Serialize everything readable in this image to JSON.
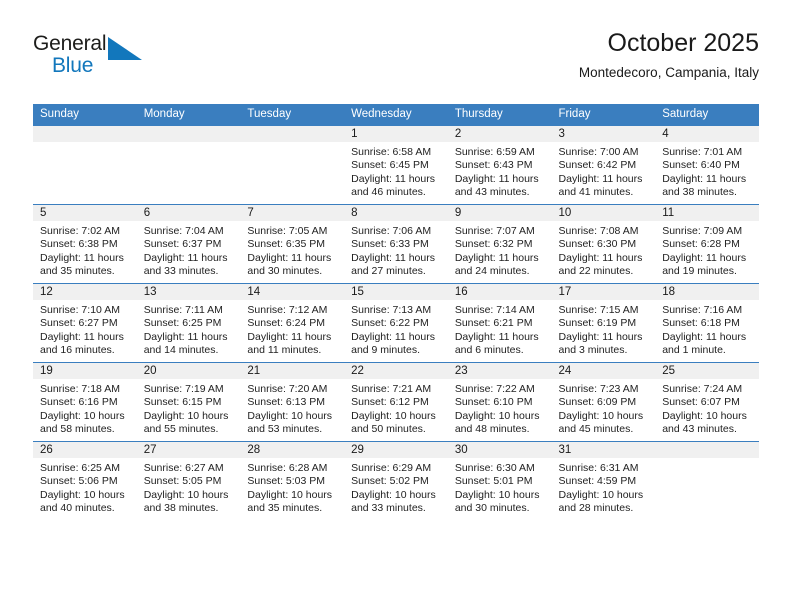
{
  "brand": {
    "name_part1": "General",
    "name_part2": "Blue",
    "triangle_color": "#1277bc"
  },
  "header": {
    "title": "October 2025",
    "subtitle": "Montedecoro, Campania, Italy",
    "accent_color": "#3a7ebf",
    "daynum_band_color": "#f0f0f0"
  },
  "weekday_headers": [
    "Sunday",
    "Monday",
    "Tuesday",
    "Wednesday",
    "Thursday",
    "Friday",
    "Saturday"
  ],
  "weeks": [
    {
      "days": [
        {
          "daynum": "",
          "sunrise": "",
          "sunset": "",
          "daylight_line1": "",
          "daylight_line2": "",
          "empty": true
        },
        {
          "daynum": "",
          "sunrise": "",
          "sunset": "",
          "daylight_line1": "",
          "daylight_line2": "",
          "empty": true
        },
        {
          "daynum": "",
          "sunrise": "",
          "sunset": "",
          "daylight_line1": "",
          "daylight_line2": "",
          "empty": true
        },
        {
          "daynum": "1",
          "sunrise": "Sunrise: 6:58 AM",
          "sunset": "Sunset: 6:45 PM",
          "daylight_line1": "Daylight: 11 hours",
          "daylight_line2": "and 46 minutes.",
          "empty": false
        },
        {
          "daynum": "2",
          "sunrise": "Sunrise: 6:59 AM",
          "sunset": "Sunset: 6:43 PM",
          "daylight_line1": "Daylight: 11 hours",
          "daylight_line2": "and 43 minutes.",
          "empty": false
        },
        {
          "daynum": "3",
          "sunrise": "Sunrise: 7:00 AM",
          "sunset": "Sunset: 6:42 PM",
          "daylight_line1": "Daylight: 11 hours",
          "daylight_line2": "and 41 minutes.",
          "empty": false
        },
        {
          "daynum": "4",
          "sunrise": "Sunrise: 7:01 AM",
          "sunset": "Sunset: 6:40 PM",
          "daylight_line1": "Daylight: 11 hours",
          "daylight_line2": "and 38 minutes.",
          "empty": false
        }
      ]
    },
    {
      "days": [
        {
          "daynum": "5",
          "sunrise": "Sunrise: 7:02 AM",
          "sunset": "Sunset: 6:38 PM",
          "daylight_line1": "Daylight: 11 hours",
          "daylight_line2": "and 35 minutes.",
          "empty": false
        },
        {
          "daynum": "6",
          "sunrise": "Sunrise: 7:04 AM",
          "sunset": "Sunset: 6:37 PM",
          "daylight_line1": "Daylight: 11 hours",
          "daylight_line2": "and 33 minutes.",
          "empty": false
        },
        {
          "daynum": "7",
          "sunrise": "Sunrise: 7:05 AM",
          "sunset": "Sunset: 6:35 PM",
          "daylight_line1": "Daylight: 11 hours",
          "daylight_line2": "and 30 minutes.",
          "empty": false
        },
        {
          "daynum": "8",
          "sunrise": "Sunrise: 7:06 AM",
          "sunset": "Sunset: 6:33 PM",
          "daylight_line1": "Daylight: 11 hours",
          "daylight_line2": "and 27 minutes.",
          "empty": false
        },
        {
          "daynum": "9",
          "sunrise": "Sunrise: 7:07 AM",
          "sunset": "Sunset: 6:32 PM",
          "daylight_line1": "Daylight: 11 hours",
          "daylight_line2": "and 24 minutes.",
          "empty": false
        },
        {
          "daynum": "10",
          "sunrise": "Sunrise: 7:08 AM",
          "sunset": "Sunset: 6:30 PM",
          "daylight_line1": "Daylight: 11 hours",
          "daylight_line2": "and 22 minutes.",
          "empty": false
        },
        {
          "daynum": "11",
          "sunrise": "Sunrise: 7:09 AM",
          "sunset": "Sunset: 6:28 PM",
          "daylight_line1": "Daylight: 11 hours",
          "daylight_line2": "and 19 minutes.",
          "empty": false
        }
      ]
    },
    {
      "days": [
        {
          "daynum": "12",
          "sunrise": "Sunrise: 7:10 AM",
          "sunset": "Sunset: 6:27 PM",
          "daylight_line1": "Daylight: 11 hours",
          "daylight_line2": "and 16 minutes.",
          "empty": false
        },
        {
          "daynum": "13",
          "sunrise": "Sunrise: 7:11 AM",
          "sunset": "Sunset: 6:25 PM",
          "daylight_line1": "Daylight: 11 hours",
          "daylight_line2": "and 14 minutes.",
          "empty": false
        },
        {
          "daynum": "14",
          "sunrise": "Sunrise: 7:12 AM",
          "sunset": "Sunset: 6:24 PM",
          "daylight_line1": "Daylight: 11 hours",
          "daylight_line2": "and 11 minutes.",
          "empty": false
        },
        {
          "daynum": "15",
          "sunrise": "Sunrise: 7:13 AM",
          "sunset": "Sunset: 6:22 PM",
          "daylight_line1": "Daylight: 11 hours",
          "daylight_line2": "and 9 minutes.",
          "empty": false
        },
        {
          "daynum": "16",
          "sunrise": "Sunrise: 7:14 AM",
          "sunset": "Sunset: 6:21 PM",
          "daylight_line1": "Daylight: 11 hours",
          "daylight_line2": "and 6 minutes.",
          "empty": false
        },
        {
          "daynum": "17",
          "sunrise": "Sunrise: 7:15 AM",
          "sunset": "Sunset: 6:19 PM",
          "daylight_line1": "Daylight: 11 hours",
          "daylight_line2": "and 3 minutes.",
          "empty": false
        },
        {
          "daynum": "18",
          "sunrise": "Sunrise: 7:16 AM",
          "sunset": "Sunset: 6:18 PM",
          "daylight_line1": "Daylight: 11 hours",
          "daylight_line2": "and 1 minute.",
          "empty": false
        }
      ]
    },
    {
      "days": [
        {
          "daynum": "19",
          "sunrise": "Sunrise: 7:18 AM",
          "sunset": "Sunset: 6:16 PM",
          "daylight_line1": "Daylight: 10 hours",
          "daylight_line2": "and 58 minutes.",
          "empty": false
        },
        {
          "daynum": "20",
          "sunrise": "Sunrise: 7:19 AM",
          "sunset": "Sunset: 6:15 PM",
          "daylight_line1": "Daylight: 10 hours",
          "daylight_line2": "and 55 minutes.",
          "empty": false
        },
        {
          "daynum": "21",
          "sunrise": "Sunrise: 7:20 AM",
          "sunset": "Sunset: 6:13 PM",
          "daylight_line1": "Daylight: 10 hours",
          "daylight_line2": "and 53 minutes.",
          "empty": false
        },
        {
          "daynum": "22",
          "sunrise": "Sunrise: 7:21 AM",
          "sunset": "Sunset: 6:12 PM",
          "daylight_line1": "Daylight: 10 hours",
          "daylight_line2": "and 50 minutes.",
          "empty": false
        },
        {
          "daynum": "23",
          "sunrise": "Sunrise: 7:22 AM",
          "sunset": "Sunset: 6:10 PM",
          "daylight_line1": "Daylight: 10 hours",
          "daylight_line2": "and 48 minutes.",
          "empty": false
        },
        {
          "daynum": "24",
          "sunrise": "Sunrise: 7:23 AM",
          "sunset": "Sunset: 6:09 PM",
          "daylight_line1": "Daylight: 10 hours",
          "daylight_line2": "and 45 minutes.",
          "empty": false
        },
        {
          "daynum": "25",
          "sunrise": "Sunrise: 7:24 AM",
          "sunset": "Sunset: 6:07 PM",
          "daylight_line1": "Daylight: 10 hours",
          "daylight_line2": "and 43 minutes.",
          "empty": false
        }
      ]
    },
    {
      "days": [
        {
          "daynum": "26",
          "sunrise": "Sunrise: 6:25 AM",
          "sunset": "Sunset: 5:06 PM",
          "daylight_line1": "Daylight: 10 hours",
          "daylight_line2": "and 40 minutes.",
          "empty": false
        },
        {
          "daynum": "27",
          "sunrise": "Sunrise: 6:27 AM",
          "sunset": "Sunset: 5:05 PM",
          "daylight_line1": "Daylight: 10 hours",
          "daylight_line2": "and 38 minutes.",
          "empty": false
        },
        {
          "daynum": "28",
          "sunrise": "Sunrise: 6:28 AM",
          "sunset": "Sunset: 5:03 PM",
          "daylight_line1": "Daylight: 10 hours",
          "daylight_line2": "and 35 minutes.",
          "empty": false
        },
        {
          "daynum": "29",
          "sunrise": "Sunrise: 6:29 AM",
          "sunset": "Sunset: 5:02 PM",
          "daylight_line1": "Daylight: 10 hours",
          "daylight_line2": "and 33 minutes.",
          "empty": false
        },
        {
          "daynum": "30",
          "sunrise": "Sunrise: 6:30 AM",
          "sunset": "Sunset: 5:01 PM",
          "daylight_line1": "Daylight: 10 hours",
          "daylight_line2": "and 30 minutes.",
          "empty": false
        },
        {
          "daynum": "31",
          "sunrise": "Sunrise: 6:31 AM",
          "sunset": "Sunset: 4:59 PM",
          "daylight_line1": "Daylight: 10 hours",
          "daylight_line2": "and 28 minutes.",
          "empty": false
        },
        {
          "daynum": "",
          "sunrise": "",
          "sunset": "",
          "daylight_line1": "",
          "daylight_line2": "",
          "empty": true
        }
      ]
    }
  ]
}
